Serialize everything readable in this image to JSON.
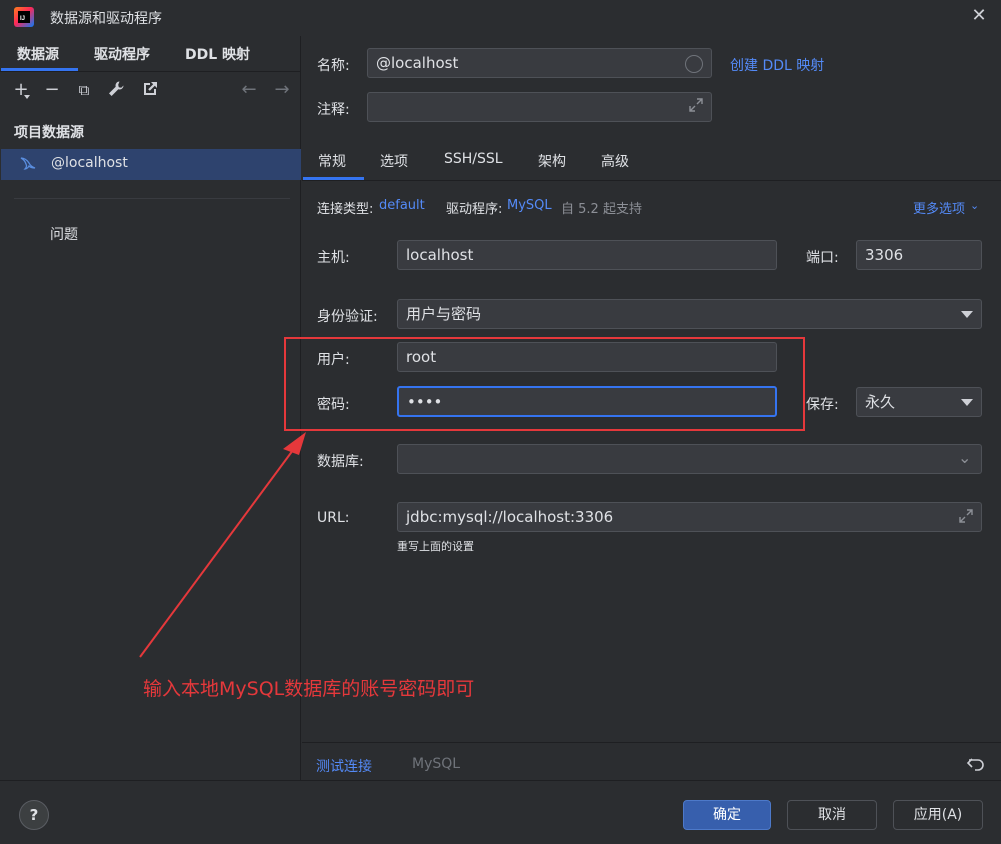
{
  "window": {
    "title": "数据源和驱动程序",
    "close": "✕"
  },
  "left": {
    "tabs": [
      "数据源",
      "驱动程序",
      "DDL 映射"
    ],
    "toolbar": {
      "add": "+",
      "remove": "−",
      "copy": "⧉",
      "wrench": "🔧",
      "export": "↗",
      "back": "←",
      "forward": "→"
    },
    "section_title": "项目数据源",
    "items": [
      {
        "label": "@localhost"
      }
    ],
    "problems": "问题"
  },
  "right": {
    "name_label": "名称:",
    "name_value": "@localhost",
    "create_ddl_link": "创建 DDL 映射",
    "comment_label": "注释:",
    "comment_value": "",
    "tabs": [
      "常规",
      "选项",
      "SSH/SSL",
      "架构",
      "高级"
    ],
    "conn_type_label": "连接类型:",
    "conn_type_value": "default",
    "driver_label": "驱动程序:",
    "driver_value": "MySQL",
    "driver_note": "自 5.2 起支持",
    "more_options": "更多选项",
    "host_label": "主机:",
    "host_value": "localhost",
    "port_label": "端口:",
    "port_value": "3306",
    "auth_label": "身份验证:",
    "auth_value": "用户与密码",
    "user_label": "用户:",
    "user_value": "root",
    "password_label": "密码:",
    "password_value": "••••",
    "save_label": "保存:",
    "save_value": "永久",
    "database_label": "数据库:",
    "database_value": "",
    "url_label": "URL:",
    "url_value": "jdbc:mysql://localhost:3306",
    "url_hint": "重写上面的设置",
    "test_connection": "测试连接",
    "driver_footer": "MySQL"
  },
  "footer": {
    "help": "?",
    "ok": "确定",
    "cancel": "取消",
    "apply": "应用(A)"
  },
  "annotation": {
    "text": "输入本地MySQL数据库的账号密码即可",
    "color": "#e5383b"
  },
  "colors": {
    "accent": "#3574f0",
    "link": "#548af7",
    "background": "#2b2d30",
    "selection": "#2e436e"
  }
}
